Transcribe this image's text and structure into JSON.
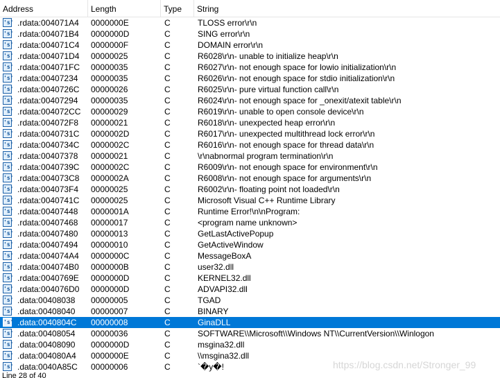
{
  "columns": {
    "address": "Address",
    "length": "Length",
    "type": "Type",
    "string": "String"
  },
  "icon": {
    "name": "string-icon",
    "glyph": "'s'"
  },
  "rows": [
    {
      "address": ".rdata:004071A4",
      "length": "0000000E",
      "type": "C",
      "string": "TLOSS error\\r\\n"
    },
    {
      "address": ".rdata:004071B4",
      "length": "0000000D",
      "type": "C",
      "string": "SING error\\r\\n"
    },
    {
      "address": ".rdata:004071C4",
      "length": "0000000F",
      "type": "C",
      "string": "DOMAIN error\\r\\n"
    },
    {
      "address": ".rdata:004071D4",
      "length": "00000025",
      "type": "C",
      "string": "R6028\\r\\n- unable to initialize heap\\r\\n"
    },
    {
      "address": ".rdata:004071FC",
      "length": "00000035",
      "type": "C",
      "string": "R6027\\r\\n- not enough space for lowio initialization\\r\\n"
    },
    {
      "address": ".rdata:00407234",
      "length": "00000035",
      "type": "C",
      "string": "R6026\\r\\n- not enough space for stdio initialization\\r\\n"
    },
    {
      "address": ".rdata:0040726C",
      "length": "00000026",
      "type": "C",
      "string": "R6025\\r\\n- pure virtual function call\\r\\n"
    },
    {
      "address": ".rdata:00407294",
      "length": "00000035",
      "type": "C",
      "string": "R6024\\r\\n- not enough space for _onexit/atexit table\\r\\n"
    },
    {
      "address": ".rdata:004072CC",
      "length": "00000029",
      "type": "C",
      "string": "R6019\\r\\n- unable to open console device\\r\\n"
    },
    {
      "address": ".rdata:004072F8",
      "length": "00000021",
      "type": "C",
      "string": "R6018\\r\\n- unexpected heap error\\r\\n"
    },
    {
      "address": ".rdata:0040731C",
      "length": "0000002D",
      "type": "C",
      "string": "R6017\\r\\n- unexpected multithread lock error\\r\\n"
    },
    {
      "address": ".rdata:0040734C",
      "length": "0000002C",
      "type": "C",
      "string": "R6016\\r\\n- not enough space for thread data\\r\\n"
    },
    {
      "address": ".rdata:00407378",
      "length": "00000021",
      "type": "C",
      "string": "\\r\\nabnormal program termination\\r\\n"
    },
    {
      "address": ".rdata:0040739C",
      "length": "0000002C",
      "type": "C",
      "string": "R6009\\r\\n- not enough space for environment\\r\\n"
    },
    {
      "address": ".rdata:004073C8",
      "length": "0000002A",
      "type": "C",
      "string": "R6008\\r\\n- not enough space for arguments\\r\\n"
    },
    {
      "address": ".rdata:004073F4",
      "length": "00000025",
      "type": "C",
      "string": "R6002\\r\\n- floating point not loaded\\r\\n"
    },
    {
      "address": ".rdata:0040741C",
      "length": "00000025",
      "type": "C",
      "string": "Microsoft Visual C++ Runtime Library"
    },
    {
      "address": ".rdata:00407448",
      "length": "0000001A",
      "type": "C",
      "string": "Runtime Error!\\n\\nProgram:"
    },
    {
      "address": ".rdata:00407468",
      "length": "00000017",
      "type": "C",
      "string": "<program name unknown>"
    },
    {
      "address": ".rdata:00407480",
      "length": "00000013",
      "type": "C",
      "string": "GetLastActivePopup"
    },
    {
      "address": ".rdata:00407494",
      "length": "00000010",
      "type": "C",
      "string": "GetActiveWindow"
    },
    {
      "address": ".rdata:004074A4",
      "length": "0000000C",
      "type": "C",
      "string": "MessageBoxA"
    },
    {
      "address": ".rdata:004074B0",
      "length": "0000000B",
      "type": "C",
      "string": "user32.dll"
    },
    {
      "address": ".rdata:0040769E",
      "length": "0000000D",
      "type": "C",
      "string": "KERNEL32.dll"
    },
    {
      "address": ".rdata:004076D0",
      "length": "0000000D",
      "type": "C",
      "string": "ADVAPI32.dll"
    },
    {
      "address": ".data:00408038",
      "length": "00000005",
      "type": "C",
      "string": "TGAD"
    },
    {
      "address": ".data:00408040",
      "length": "00000007",
      "type": "C",
      "string": "BINARY"
    },
    {
      "address": ".data:0040804C",
      "length": "00000008",
      "type": "C",
      "string": "GinaDLL",
      "selected": true
    },
    {
      "address": ".data:00408054",
      "length": "00000036",
      "type": "C",
      "string": "SOFTWARE\\\\Microsoft\\\\Windows NT\\\\CurrentVersion\\\\Winlogon"
    },
    {
      "address": ".data:00408090",
      "length": "0000000D",
      "type": "C",
      "string": "msgina32.dll"
    },
    {
      "address": ".data:004080A4",
      "length": "0000000E",
      "type": "C",
      "string": "\\\\msgina32.dll"
    },
    {
      "address": ".data:0040A85C",
      "length": "00000006",
      "type": "C",
      "string": "`�y�!"
    }
  ],
  "watermark": "https://blog.csdn.net/Stronger_99",
  "status": "Line 28 of 40",
  "colors": {
    "selection": "#0078d7",
    "icon_border": "#1a5fa8"
  }
}
